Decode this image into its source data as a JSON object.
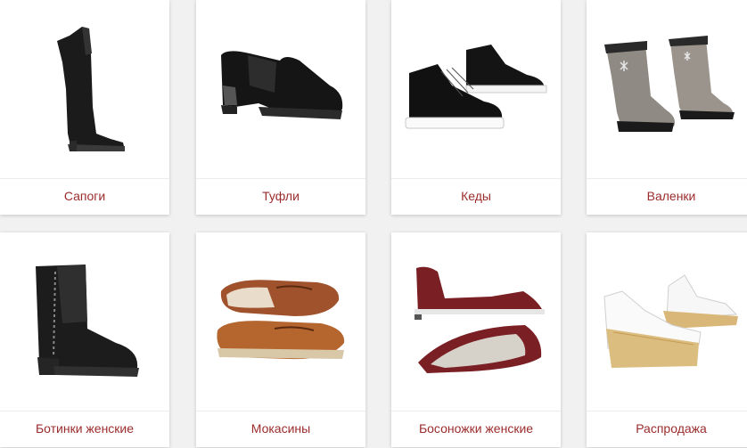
{
  "categories": [
    {
      "label": "Сапоги",
      "icon": "boot-icon"
    },
    {
      "label": "Туфли",
      "icon": "shoe-icon"
    },
    {
      "label": "Кеды",
      "icon": "sneaker-icon"
    },
    {
      "label": "Валенки",
      "icon": "felt-boot-icon"
    },
    {
      "label": "Ботинки женские",
      "icon": "ankle-boot-icon"
    },
    {
      "label": "Мокасины",
      "icon": "moccasin-icon"
    },
    {
      "label": "Босоножки женские",
      "icon": "sandal-icon"
    },
    {
      "label": "Распродажа",
      "icon": "wedge-sandal-icon"
    }
  ],
  "colors": {
    "label_text": "#9b2c2c",
    "card_bg": "#ffffff",
    "page_bg": "#f1f1f1"
  }
}
